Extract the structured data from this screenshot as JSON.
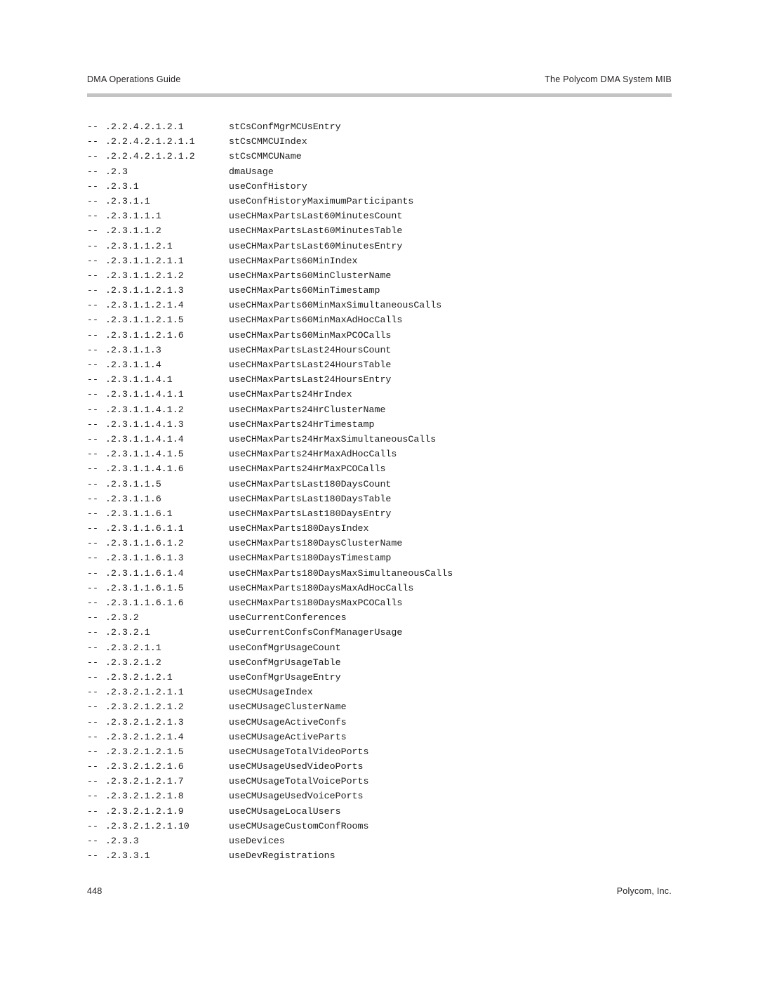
{
  "document": {
    "header": {
      "left": "DMA Operations Guide",
      "right": "The Polycom DMA System MIB",
      "rule_color": "#c3c3c3"
    },
    "footer": {
      "left": "448",
      "right": "Polycom, Inc."
    },
    "page_number": "448",
    "text_color": "#1a1a1a",
    "background_color": "#ffffff"
  },
  "listing": {
    "comment_marker": "--",
    "rows": [
      {
        "marker": "--",
        "oid": ".2.2.4.2.1.2.1",
        "name": "stCsConfMgrMCUsEntry"
      },
      {
        "marker": "--",
        "oid": ".2.2.4.2.1.2.1.1",
        "name": "stCsCMMCUIndex"
      },
      {
        "marker": "--",
        "oid": ".2.2.4.2.1.2.1.2",
        "name": "stCsCMMCUName"
      },
      {
        "marker": "--",
        "oid": ".2.3",
        "name": "dmaUsage"
      },
      {
        "marker": "--",
        "oid": ".2.3.1",
        "name": "useConfHistory"
      },
      {
        "marker": "--",
        "oid": ".2.3.1.1",
        "name": "useConfHistoryMaximumParticipants"
      },
      {
        "marker": "--",
        "oid": ".2.3.1.1.1",
        "name": "useCHMaxPartsLast60MinutesCount"
      },
      {
        "marker": "--",
        "oid": ".2.3.1.1.2",
        "name": "useCHMaxPartsLast60MinutesTable"
      },
      {
        "marker": "--",
        "oid": ".2.3.1.1.2.1",
        "name": "useCHMaxPartsLast60MinutesEntry"
      },
      {
        "marker": "--",
        "oid": ".2.3.1.1.2.1.1",
        "name": "useCHMaxParts60MinIndex"
      },
      {
        "marker": "--",
        "oid": ".2.3.1.1.2.1.2",
        "name": "useCHMaxParts60MinClusterName"
      },
      {
        "marker": "--",
        "oid": ".2.3.1.1.2.1.3",
        "name": "useCHMaxParts60MinTimestamp"
      },
      {
        "marker": "--",
        "oid": ".2.3.1.1.2.1.4",
        "name": "useCHMaxParts60MinMaxSimultaneousCalls"
      },
      {
        "marker": "--",
        "oid": ".2.3.1.1.2.1.5",
        "name": "useCHMaxParts60MinMaxAdHocCalls"
      },
      {
        "marker": "--",
        "oid": ".2.3.1.1.2.1.6",
        "name": "useCHMaxParts60MinMaxPCOCalls"
      },
      {
        "marker": "--",
        "oid": ".2.3.1.1.3",
        "name": "useCHMaxPartsLast24HoursCount"
      },
      {
        "marker": "--",
        "oid": ".2.3.1.1.4",
        "name": "useCHMaxPartsLast24HoursTable"
      },
      {
        "marker": "--",
        "oid": ".2.3.1.1.4.1",
        "name": "useCHMaxPartsLast24HoursEntry"
      },
      {
        "marker": "--",
        "oid": ".2.3.1.1.4.1.1",
        "name": "useCHMaxParts24HrIndex"
      },
      {
        "marker": "--",
        "oid": ".2.3.1.1.4.1.2",
        "name": "useCHMaxParts24HrClusterName"
      },
      {
        "marker": "--",
        "oid": ".2.3.1.1.4.1.3",
        "name": "useCHMaxParts24HrTimestamp"
      },
      {
        "marker": "--",
        "oid": ".2.3.1.1.4.1.4",
        "name": "useCHMaxParts24HrMaxSimultaneousCalls"
      },
      {
        "marker": "--",
        "oid": ".2.3.1.1.4.1.5",
        "name": "useCHMaxParts24HrMaxAdHocCalls"
      },
      {
        "marker": "--",
        "oid": ".2.3.1.1.4.1.6",
        "name": "useCHMaxParts24HrMaxPCOCalls"
      },
      {
        "marker": "--",
        "oid": ".2.3.1.1.5",
        "name": "useCHMaxPartsLast180DaysCount"
      },
      {
        "marker": "--",
        "oid": ".2.3.1.1.6",
        "name": "useCHMaxPartsLast180DaysTable"
      },
      {
        "marker": "--",
        "oid": ".2.3.1.1.6.1",
        "name": "useCHMaxPartsLast180DaysEntry"
      },
      {
        "marker": "--",
        "oid": ".2.3.1.1.6.1.1",
        "name": "useCHMaxParts180DaysIndex"
      },
      {
        "marker": "--",
        "oid": ".2.3.1.1.6.1.2",
        "name": "useCHMaxParts180DaysClusterName"
      },
      {
        "marker": "--",
        "oid": ".2.3.1.1.6.1.3",
        "name": "useCHMaxParts180DaysTimestamp"
      },
      {
        "marker": "--",
        "oid": ".2.3.1.1.6.1.4",
        "name": "useCHMaxParts180DaysMaxSimultaneousCalls"
      },
      {
        "marker": "--",
        "oid": ".2.3.1.1.6.1.5",
        "name": "useCHMaxParts180DaysMaxAdHocCalls"
      },
      {
        "marker": "--",
        "oid": ".2.3.1.1.6.1.6",
        "name": "useCHMaxParts180DaysMaxPCOCalls"
      },
      {
        "marker": "--",
        "oid": ".2.3.2",
        "name": "useCurrentConferences"
      },
      {
        "marker": "--",
        "oid": ".2.3.2.1",
        "name": "useCurrentConfsConfManagerUsage"
      },
      {
        "marker": "--",
        "oid": ".2.3.2.1.1",
        "name": "useConfMgrUsageCount"
      },
      {
        "marker": "--",
        "oid": ".2.3.2.1.2",
        "name": "useConfMgrUsageTable"
      },
      {
        "marker": "--",
        "oid": ".2.3.2.1.2.1",
        "name": "useConfMgrUsageEntry"
      },
      {
        "marker": "--",
        "oid": ".2.3.2.1.2.1.1",
        "name": "useCMUsageIndex"
      },
      {
        "marker": "--",
        "oid": ".2.3.2.1.2.1.2",
        "name": "useCMUsageClusterName"
      },
      {
        "marker": "--",
        "oid": ".2.3.2.1.2.1.3",
        "name": "useCMUsageActiveConfs"
      },
      {
        "marker": "--",
        "oid": ".2.3.2.1.2.1.4",
        "name": "useCMUsageActiveParts"
      },
      {
        "marker": "--",
        "oid": ".2.3.2.1.2.1.5",
        "name": "useCMUsageTotalVideoPorts"
      },
      {
        "marker": "--",
        "oid": ".2.3.2.1.2.1.6",
        "name": "useCMUsageUsedVideoPorts"
      },
      {
        "marker": "--",
        "oid": ".2.3.2.1.2.1.7",
        "name": "useCMUsageTotalVoicePorts"
      },
      {
        "marker": "--",
        "oid": ".2.3.2.1.2.1.8",
        "name": "useCMUsageUsedVoicePorts"
      },
      {
        "marker": "--",
        "oid": ".2.3.2.1.2.1.9",
        "name": "useCMUsageLocalUsers"
      },
      {
        "marker": "--",
        "oid": ".2.3.2.1.2.1.10",
        "name": "useCMUsageCustomConfRooms"
      },
      {
        "marker": "--",
        "oid": ".2.3.3",
        "name": "useDevices"
      },
      {
        "marker": "--",
        "oid": ".2.3.3.1",
        "name": "useDevRegistrations"
      }
    ]
  }
}
